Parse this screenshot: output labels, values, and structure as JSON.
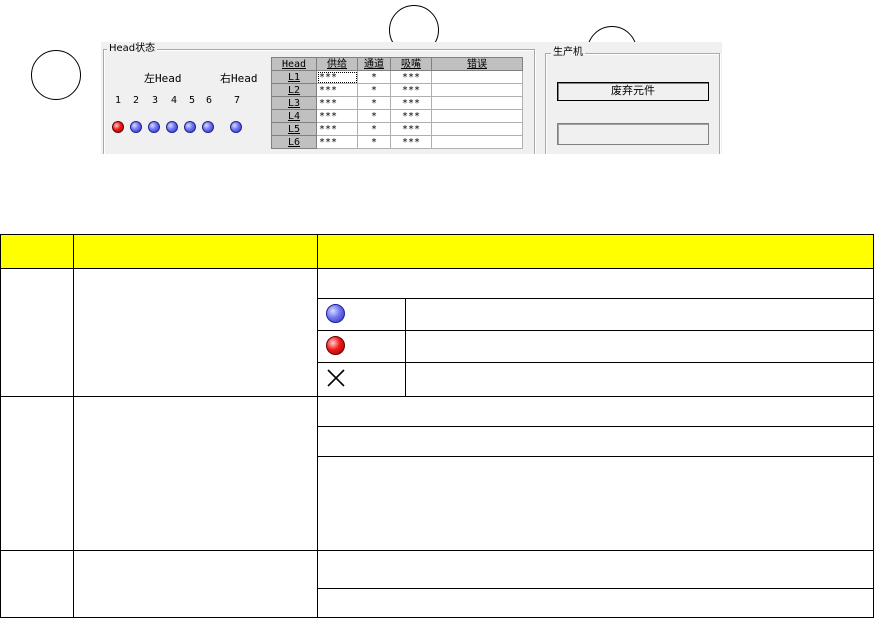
{
  "screenshot": {
    "head_state_title": "Head状态",
    "left_head_label": "左Head",
    "right_head_label": "右Head",
    "head_numbers": [
      "1",
      "2",
      "3",
      "4",
      "5",
      "6",
      "7"
    ],
    "head_states": [
      "red",
      "blue",
      "blue",
      "blue",
      "blue",
      "blue",
      "blue"
    ],
    "table": {
      "columns": [
        "Head",
        "供给",
        "通道",
        "吸嘴",
        "错误"
      ],
      "rows": [
        {
          "head": "L1",
          "supply": "***",
          "channel": "*",
          "nozzle": "***",
          "error": ""
        },
        {
          "head": "L2",
          "supply": "***",
          "channel": "*",
          "nozzle": "***",
          "error": ""
        },
        {
          "head": "L3",
          "supply": "***",
          "channel": "*",
          "nozzle": "***",
          "error": ""
        },
        {
          "head": "L4",
          "supply": "***",
          "channel": "*",
          "nozzle": "***",
          "error": ""
        },
        {
          "head": "L5",
          "supply": "***",
          "channel": "*",
          "nozzle": "***",
          "error": ""
        },
        {
          "head": "L6",
          "supply": "***",
          "channel": "*",
          "nozzle": "***",
          "error": ""
        }
      ]
    },
    "production_title": "生产机",
    "discard_button": "废弃元件"
  },
  "legend_icons": [
    "blue-ball-icon",
    "red-ball-icon",
    "cross-icon"
  ],
  "colors": {
    "header_fill": "#ffff00",
    "state_blue": "#5a60e8",
    "state_red": "#e81010"
  }
}
